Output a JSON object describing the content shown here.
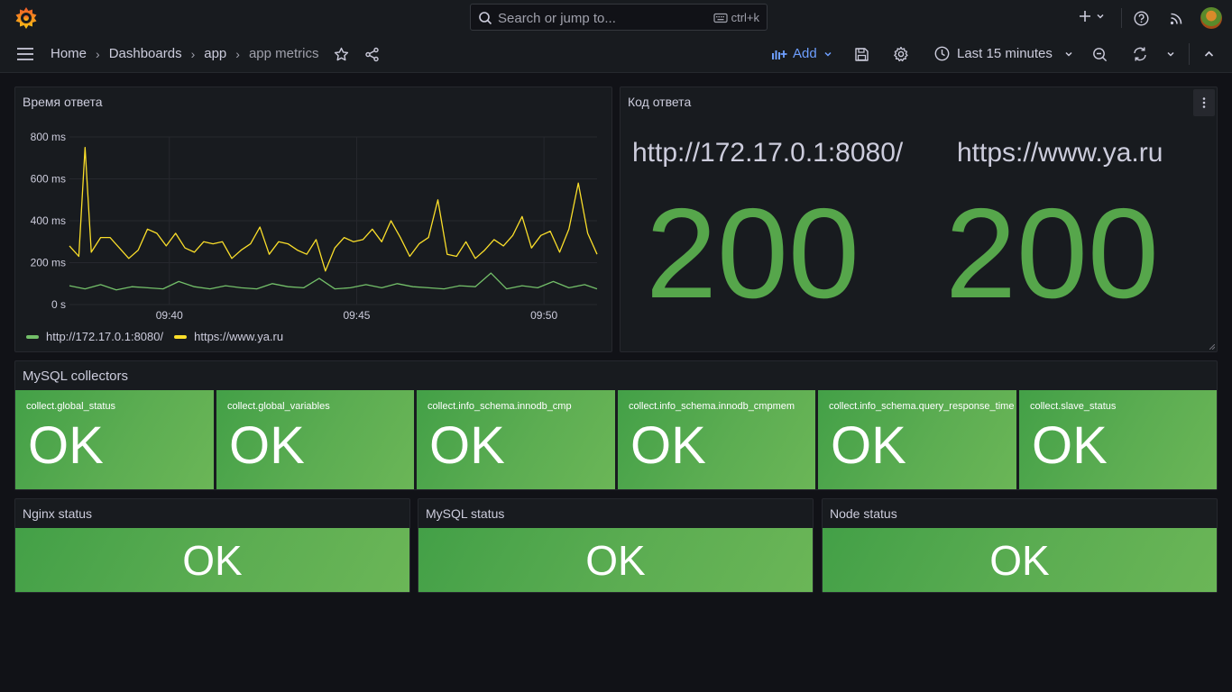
{
  "topbar": {
    "search_placeholder": "Search or jump to...",
    "search_shortcut": "ctrl+k",
    "icons": [
      "grafana-logo-icon",
      "search-icon",
      "keyboard-icon",
      "plus-icon",
      "chevron-down-icon",
      "help-icon",
      "rss-icon",
      "avatar"
    ]
  },
  "nav": {
    "breadcrumbs": [
      {
        "label": "Home"
      },
      {
        "label": "Dashboards"
      },
      {
        "label": "app"
      },
      {
        "label": "app metrics"
      }
    ],
    "add_label": "Add",
    "time_range": "Last 15 minutes"
  },
  "panels": {
    "response_time": {
      "title": "Время ответа",
      "legend": [
        {
          "name": "http://172.17.0.1:8080/",
          "color": "#73bf69"
        },
        {
          "name": "https://www.ya.ru",
          "color": "#fade2a"
        }
      ]
    },
    "response_code": {
      "title": "Код ответа",
      "items": [
        {
          "url": "http://172.17.0.1:8080/",
          "code": "200"
        },
        {
          "url": "https://www.ya.ru",
          "code": "200"
        }
      ],
      "value_color": "#56a64b"
    }
  },
  "chart_data": {
    "type": "line",
    "title": "Время ответа",
    "xlabel": "",
    "ylabel": "",
    "x_ticks": [
      "09:40",
      "09:45",
      "09:50"
    ],
    "y_ticks": [
      "0 s",
      "200 ms",
      "400 ms",
      "600 ms",
      "800 ms"
    ],
    "ylim": [
      0,
      800
    ],
    "x_range": [
      "09:37:20",
      "09:51:25"
    ],
    "grid": true,
    "legend_position": "bottom-left",
    "series": [
      {
        "name": "http://172.17.0.1:8080/",
        "color": "#73bf69",
        "x": [
          "09:37:20",
          "09:37:45",
          "09:38:10",
          "09:38:35",
          "09:39:00",
          "09:39:25",
          "09:39:50",
          "09:40:15",
          "09:40:40",
          "09:41:05",
          "09:41:30",
          "09:41:55",
          "09:42:20",
          "09:42:45",
          "09:43:10",
          "09:43:35",
          "09:44:00",
          "09:44:25",
          "09:44:50",
          "09:45:15",
          "09:45:40",
          "09:46:05",
          "09:46:30",
          "09:46:55",
          "09:47:20",
          "09:47:45",
          "09:48:10",
          "09:48:35",
          "09:49:00",
          "09:49:25",
          "09:49:50",
          "09:50:15",
          "09:50:40",
          "09:51:05",
          "09:51:25"
        ],
        "values": [
          90,
          75,
          95,
          70,
          85,
          80,
          75,
          110,
          85,
          75,
          90,
          80,
          75,
          100,
          85,
          80,
          125,
          75,
          80,
          95,
          80,
          100,
          85,
          80,
          75,
          90,
          85,
          150,
          75,
          90,
          80,
          110,
          80,
          95,
          75
        ]
      },
      {
        "name": "https://www.ya.ru",
        "color": "#fade2a",
        "x": [
          "09:37:20",
          "09:37:35",
          "09:37:45",
          "09:37:55",
          "09:38:10",
          "09:38:25",
          "09:38:40",
          "09:38:55",
          "09:39:10",
          "09:39:25",
          "09:39:40",
          "09:39:55",
          "09:40:10",
          "09:40:25",
          "09:40:40",
          "09:40:55",
          "09:41:10",
          "09:41:25",
          "09:41:40",
          "09:41:55",
          "09:42:10",
          "09:42:25",
          "09:42:40",
          "09:42:55",
          "09:43:10",
          "09:43:25",
          "09:43:40",
          "09:43:55",
          "09:44:10",
          "09:44:25",
          "09:44:40",
          "09:44:55",
          "09:45:10",
          "09:45:25",
          "09:45:40",
          "09:45:55",
          "09:46:10",
          "09:46:25",
          "09:46:40",
          "09:46:55",
          "09:47:10",
          "09:47:25",
          "09:47:40",
          "09:47:55",
          "09:48:10",
          "09:48:25",
          "09:48:40",
          "09:48:55",
          "09:49:10",
          "09:49:25",
          "09:49:40",
          "09:49:55",
          "09:50:10",
          "09:50:25",
          "09:50:40",
          "09:50:55",
          "09:51:10",
          "09:51:25"
        ],
        "values": [
          280,
          230,
          750,
          250,
          320,
          320,
          270,
          220,
          260,
          360,
          340,
          280,
          340,
          270,
          250,
          300,
          290,
          300,
          220,
          260,
          290,
          370,
          240,
          300,
          290,
          260,
          240,
          310,
          160,
          270,
          320,
          300,
          310,
          360,
          300,
          400,
          320,
          230,
          290,
          320,
          500,
          240,
          230,
          300,
          220,
          260,
          310,
          280,
          330,
          420,
          270,
          330,
          350,
          250,
          360,
          580,
          340,
          240
        ]
      }
    ]
  },
  "mysql_collectors": {
    "title": "MySQL collectors",
    "items": [
      {
        "name": "collect.global_status",
        "value": "OK"
      },
      {
        "name": "collect.global_variables",
        "value": "OK"
      },
      {
        "name": "collect.info_schema.innodb_cmp",
        "value": "OK"
      },
      {
        "name": "collect.info_schema.innodb_cmpmem",
        "value": "OK"
      },
      {
        "name": "collect.info_schema.query_response_time",
        "value": "OK"
      },
      {
        "name": "collect.slave_status",
        "value": "OK"
      }
    ]
  },
  "status_panels": [
    {
      "title": "Nginx status",
      "value": "OK"
    },
    {
      "title": "MySQL status",
      "value": "OK"
    },
    {
      "title": "Node status",
      "value": "OK"
    }
  ],
  "colors": {
    "ok_green": "#56a64b",
    "background": "#111217",
    "panel": "#181b1f",
    "accent_blue": "#6e9fff"
  }
}
